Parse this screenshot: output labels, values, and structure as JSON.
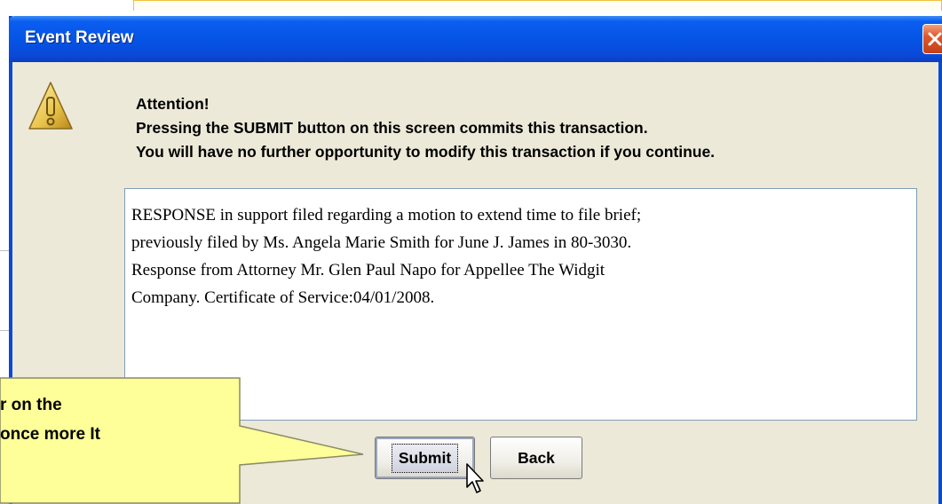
{
  "dialog": {
    "title": "Event Review",
    "message_heading": "Attention!",
    "message_line_1": "Pressing the SUBMIT button on this screen commits this transaction.",
    "message_line_2": "You will have no further opportunity to modify this transaction if you continue.",
    "docket_text": {
      "line_1": "RESPONSE in support filed regarding a motion to extend time to file brief;",
      "line_2": "previously filed by Ms. Angela Marie Smith for June J. James in 80-3030.",
      "line_3": "Response from Attorney Mr. Glen Paul Napo for Appellee The Widgit",
      "line_4": "Company. Certificate of Service:04/01/2008."
    },
    "buttons": {
      "submit": "Submit",
      "back": "Back"
    }
  },
  "callout": {
    "line_1": "r on the",
    "line_2": "once more It"
  },
  "icons": {
    "close": "close-icon",
    "warning": "warning-icon",
    "cursor": "mouse-cursor-icon"
  },
  "colors": {
    "titlebar": "#0a49d8",
    "dialog_bg": "#ece9d8",
    "callout_bg": "#ffff99",
    "close": "#e0582a"
  }
}
